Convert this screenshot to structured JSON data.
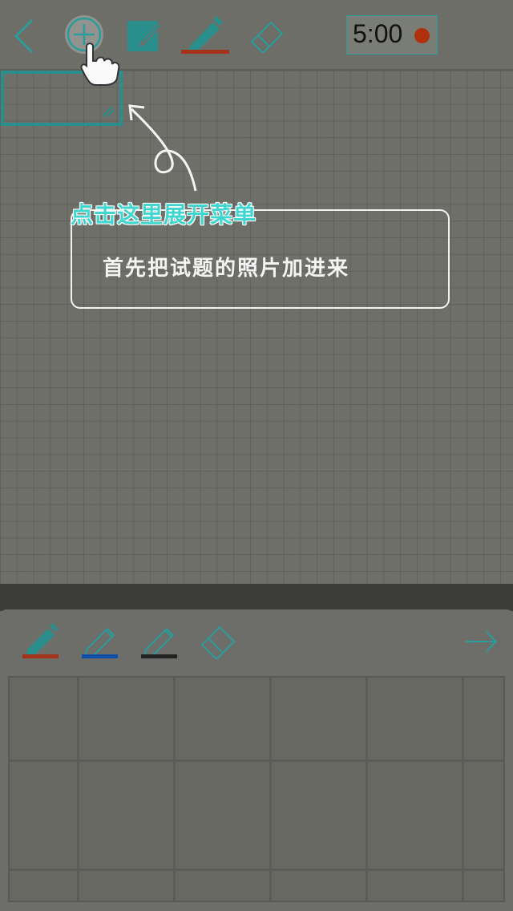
{
  "toolbar": {
    "back_icon": "chevron-left-icon",
    "add_icon": "plus-circle-icon",
    "edit_icon": "edit-square-icon",
    "pen_icon": "pencil-icon",
    "pen_color": "#a5321a",
    "eraser_icon": "eraser-icon",
    "timer": "5:00",
    "record_color": "#b0300c"
  },
  "tutorial": {
    "title": "点击这里展开菜单",
    "message": "首先把试题的照片加进来"
  },
  "panel": {
    "pens": [
      {
        "icon": "pencil-icon",
        "color": "#a5321a"
      },
      {
        "icon": "pencil-outline-icon",
        "color": "#0a4fa8"
      },
      {
        "icon": "pencil-outline-icon",
        "color": "#222222"
      }
    ],
    "eraser_icon": "eraser-icon",
    "next_icon": "arrow-right-icon"
  },
  "colors": {
    "accent": "#2a9c9a",
    "background": "#6e6f69"
  }
}
